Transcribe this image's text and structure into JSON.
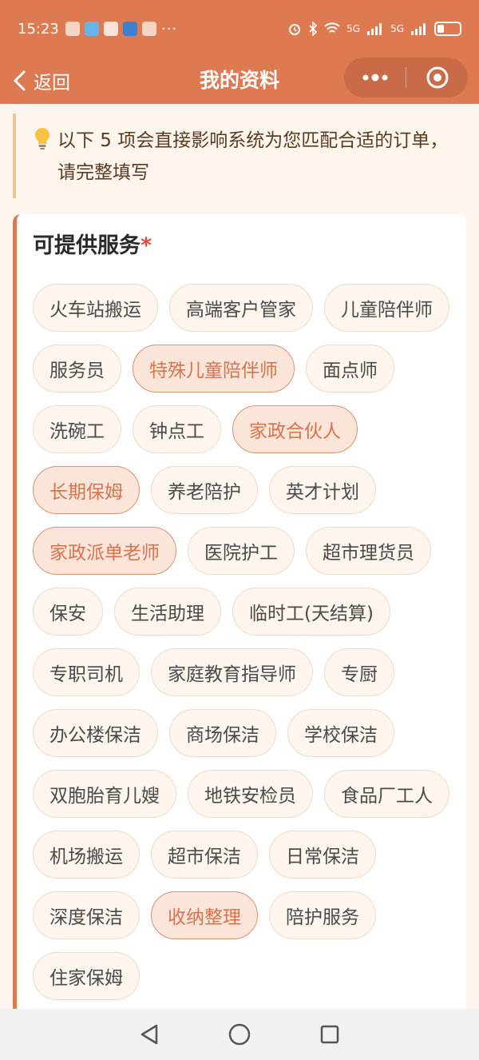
{
  "status_bar": {
    "time": "15:23",
    "more": "···",
    "network": "5G"
  },
  "nav": {
    "back_label": "返回",
    "title": "我的资料"
  },
  "notice": {
    "text": "以下 5 项会直接影响系统为您匹配合适的订单，请完整填写"
  },
  "services": {
    "title": "可提供服务",
    "required_mark": "*",
    "chips": [
      {
        "label": "火车站搬运",
        "selected": false
      },
      {
        "label": "高端客户管家",
        "selected": false
      },
      {
        "label": "儿童陪伴师",
        "selected": false
      },
      {
        "label": "服务员",
        "selected": false
      },
      {
        "label": "特殊儿童陪伴师",
        "selected": true
      },
      {
        "label": "面点师",
        "selected": false
      },
      {
        "label": "洗碗工",
        "selected": false
      },
      {
        "label": "钟点工",
        "selected": false
      },
      {
        "label": "家政合伙人",
        "selected": true
      },
      {
        "label": "长期保姆",
        "selected": true
      },
      {
        "label": "养老陪护",
        "selected": false
      },
      {
        "label": "英才计划",
        "selected": false
      },
      {
        "label": "家政派单老师",
        "selected": true
      },
      {
        "label": "医院护工",
        "selected": false
      },
      {
        "label": "超市理货员",
        "selected": false
      },
      {
        "label": "保安",
        "selected": false
      },
      {
        "label": "生活助理",
        "selected": false
      },
      {
        "label": "临时工(天结算)",
        "selected": false
      },
      {
        "label": "专职司机",
        "selected": false
      },
      {
        "label": "家庭教育指导师",
        "selected": false
      },
      {
        "label": "专厨",
        "selected": false
      },
      {
        "label": "办公楼保洁",
        "selected": false
      },
      {
        "label": "商场保洁",
        "selected": false
      },
      {
        "label": "学校保洁",
        "selected": false
      },
      {
        "label": "双胞胎育儿嫂",
        "selected": false
      },
      {
        "label": "地铁安检员",
        "selected": false
      },
      {
        "label": "食品厂工人",
        "selected": false
      },
      {
        "label": "机场搬运",
        "selected": false
      },
      {
        "label": "超市保洁",
        "selected": false
      },
      {
        "label": "日常保洁",
        "selected": false
      },
      {
        "label": "深度保洁",
        "selected": false
      },
      {
        "label": "收纳整理",
        "selected": true
      },
      {
        "label": "陪护服务",
        "selected": false
      },
      {
        "label": "住家保姆",
        "selected": false
      }
    ]
  },
  "colors": {
    "brand": "#de7a52",
    "selected_text": "#d7744f",
    "required": "#e24b3b"
  },
  "icons": {
    "notice": "lightbulb-icon",
    "back": "chevron-left-icon",
    "more": "more-dots-icon",
    "close": "target-close-icon"
  }
}
